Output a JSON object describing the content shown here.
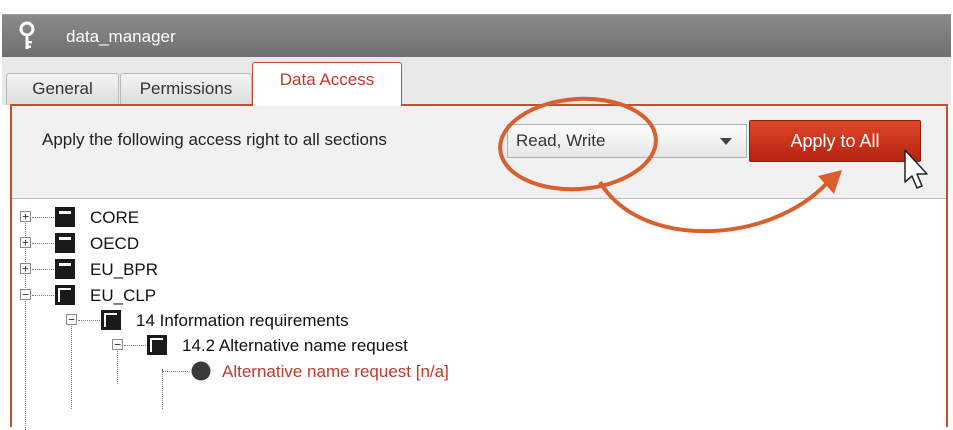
{
  "window": {
    "title": "data_manager"
  },
  "tabs": [
    {
      "label": "General",
      "active": false
    },
    {
      "label": "Permissions",
      "active": false
    },
    {
      "label": "Data Access",
      "active": true
    }
  ],
  "access": {
    "label": "Apply the following access right to all sections",
    "selected_value": "Read, Write",
    "apply_button": "Apply to All"
  },
  "tree": [
    {
      "label": "CORE",
      "expander": "+"
    },
    {
      "label": "OECD",
      "expander": "+"
    },
    {
      "label": "EU_BPR",
      "expander": "+"
    },
    {
      "label": "EU_CLP",
      "expander": "−"
    },
    {
      "label": "14 Information requirements",
      "expander": "−"
    },
    {
      "label": "14.2 Alternative name request",
      "expander": "−"
    },
    {
      "label": "Alternative name request [n/a]"
    }
  ],
  "colors": {
    "accent": "#c74d2f",
    "button": "#c92d14",
    "highlight_text": "#c0392b"
  },
  "icons": {
    "window": "key-icon",
    "section": "folder-icon",
    "leaf": "circle-icon",
    "pointer": "cursor-arrow-icon"
  }
}
